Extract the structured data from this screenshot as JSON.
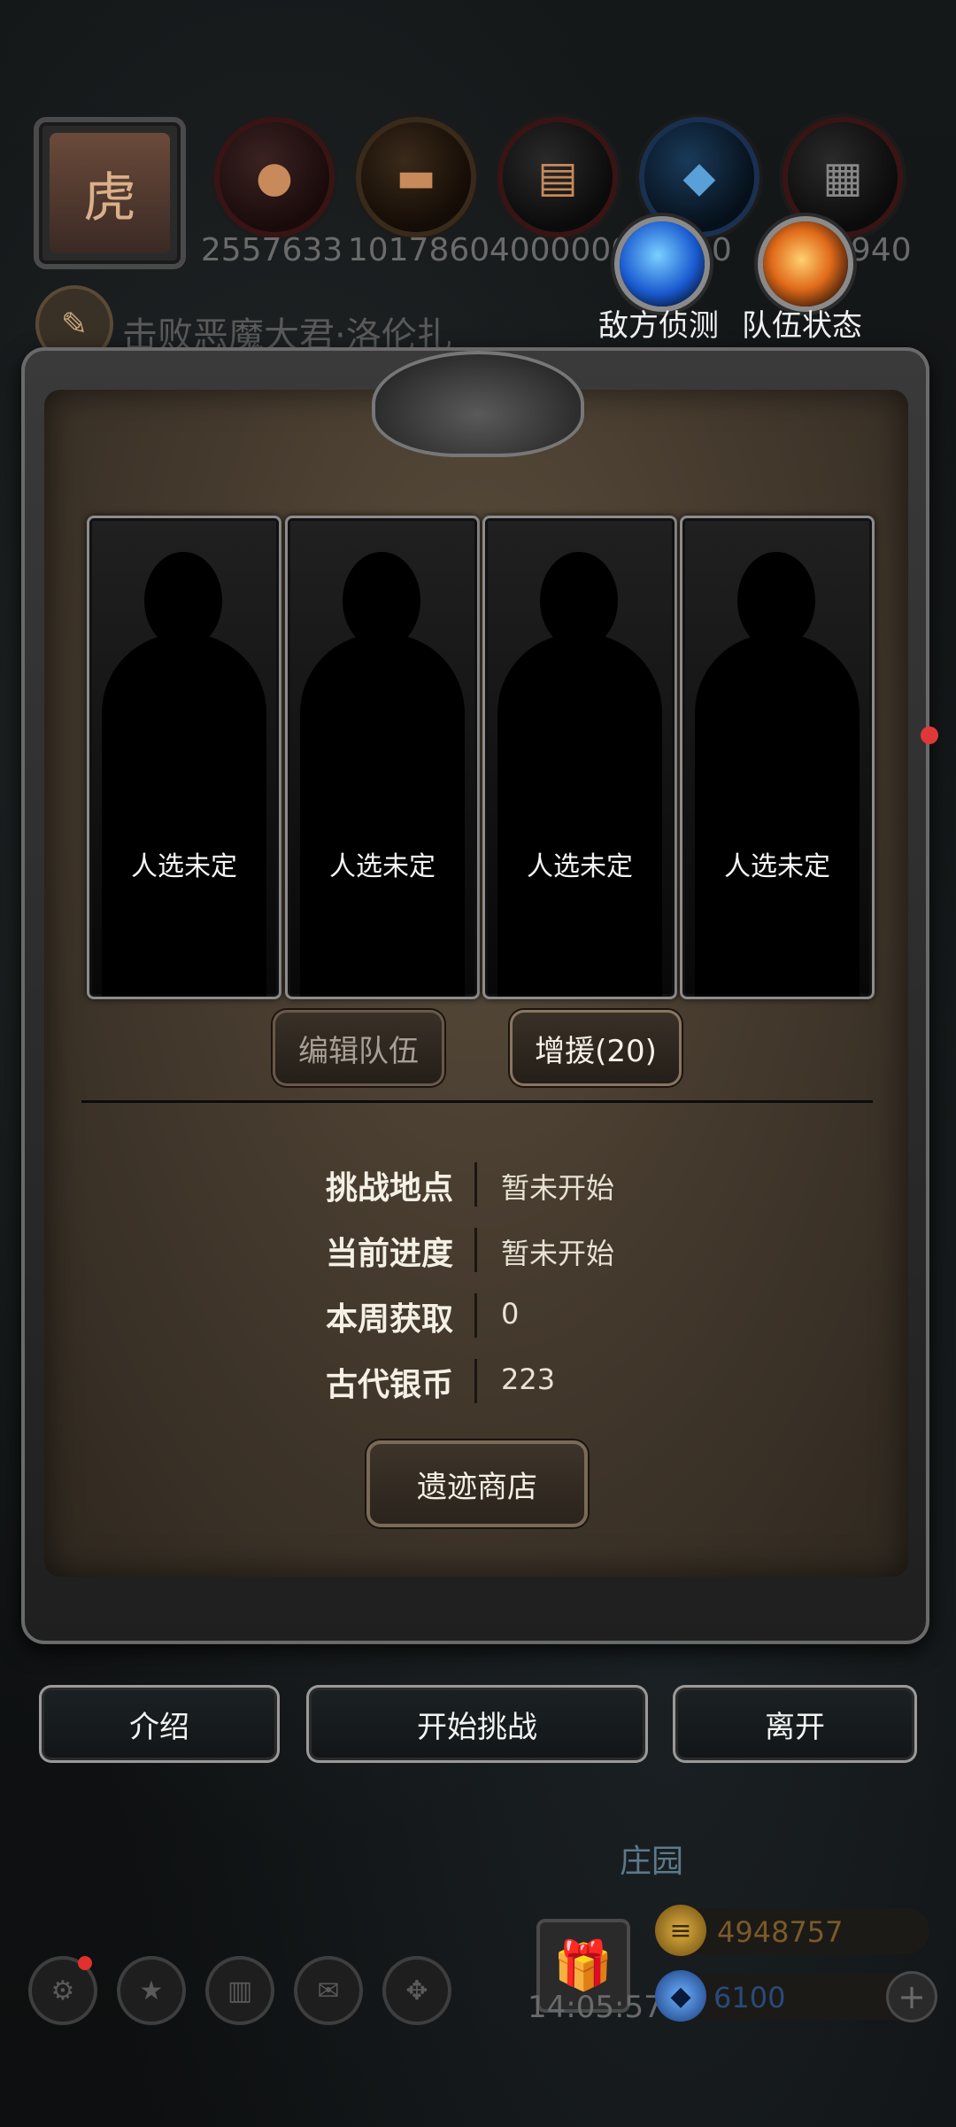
{
  "resources": [
    {
      "icon": "meat-icon",
      "value": "2557633"
    },
    {
      "icon": "wood-icon",
      "value": "1017860"
    },
    {
      "icon": "iron-icon",
      "value": "4000000"
    },
    {
      "icon": "crystal-icon",
      "value": "0000"
    },
    {
      "icon": "stone-icon",
      "value": "0940"
    }
  ],
  "orbs": {
    "enemy_scout": "敌方侦测",
    "team_status": "队伍状态"
  },
  "quest": {
    "text": "击败恶魔大君·洛伦扎"
  },
  "team_slots": [
    {
      "label": "人选未定"
    },
    {
      "label": "人选未定"
    },
    {
      "label": "人选未定"
    },
    {
      "label": "人选未定"
    }
  ],
  "buttons": {
    "edit_team": "编辑队伍",
    "reinforce": "增援(20)",
    "shop": "遗迹商店",
    "intro": "介绍",
    "start": "开始挑战",
    "leave": "离开"
  },
  "info": [
    {
      "label": "挑战地点",
      "value": "暂未开始"
    },
    {
      "label": "当前进度",
      "value": "暂未开始"
    },
    {
      "label": "本周获取",
      "value": "0"
    },
    {
      "label": "古代银币",
      "value": "223"
    }
  ],
  "bottom": {
    "manor": "庄园",
    "time": "14:05:57",
    "gold": "4948757",
    "gems": "6100"
  },
  "colors": {
    "panel": "#463b2e",
    "gold_text": "#7a5a2a",
    "gem_text": "#2a4a7a",
    "alert_red": "#e03030"
  }
}
